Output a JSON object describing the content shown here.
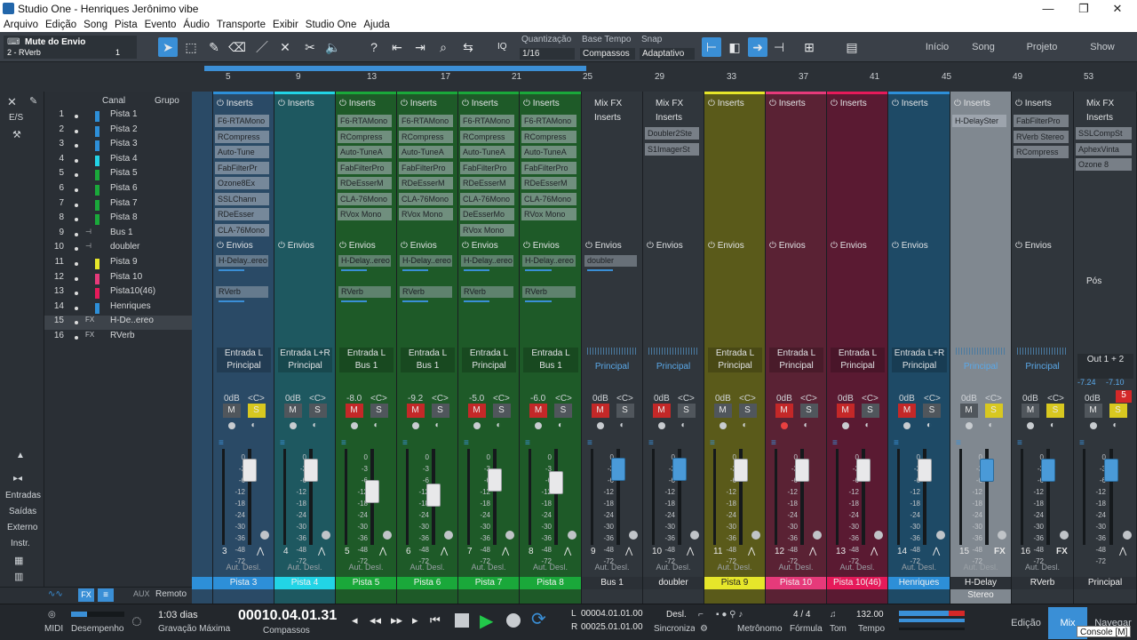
{
  "window": {
    "title": "Studio One - Henriques Jerônimo vibe",
    "min": "—",
    "max": "❐",
    "close": "✕"
  },
  "menu": [
    "Arquivo",
    "Edição",
    "Song",
    "Pista",
    "Evento",
    "Áudio",
    "Transporte",
    "Exibir",
    "Studio One",
    "Ajuda"
  ],
  "toolbar": {
    "track_label": "Mute do Envio",
    "track_sub": "2 - RVerb",
    "track_num": "1",
    "quant_label": "Quantização",
    "quant_value": "1/16",
    "timebase_label": "Base Tempo",
    "timebase_value": "Compassos",
    "snap_label": "Snap",
    "snap_value": "Adaptativo",
    "iq": "IQ",
    "nav": {
      "start": "Início",
      "song": "Song",
      "project": "Projeto",
      "show": "Show"
    }
  },
  "ruler": [
    "5",
    "9",
    "13",
    "17",
    "21",
    "25",
    "29",
    "33",
    "37",
    "41",
    "45",
    "49",
    "53"
  ],
  "left_tools": {
    "io": "E/S",
    "entradas": "Entradas",
    "saidas": "Saídas",
    "externo": "Externo",
    "instr": "Instr."
  },
  "chanlist": {
    "col_canal": "Canal",
    "col_grupo": "Grupo",
    "rows": [
      {
        "n": "1",
        "name": "Pista 1",
        "color": "#2d8fd8"
      },
      {
        "n": "2",
        "name": "Pista 2",
        "color": "#2d8fd8"
      },
      {
        "n": "3",
        "name": "Pista 3",
        "color": "#2d8fd8"
      },
      {
        "n": "4",
        "name": "Pista 4",
        "color": "#22d4e6"
      },
      {
        "n": "5",
        "name": "Pista 5",
        "color": "#1aa83a"
      },
      {
        "n": "6",
        "name": "Pista 6",
        "color": "#1aa83a"
      },
      {
        "n": "7",
        "name": "Pista 7",
        "color": "#1aa83a"
      },
      {
        "n": "8",
        "name": "Pista 8",
        "color": "#1aa83a"
      },
      {
        "n": "9",
        "name": "Bus 1",
        "color": ""
      },
      {
        "n": "10",
        "name": "doubler",
        "color": ""
      },
      {
        "n": "11",
        "name": "Pista 9",
        "color": "#e6e62a"
      },
      {
        "n": "12",
        "name": "Pista 10",
        "color": "#e63a7a"
      },
      {
        "n": "13",
        "name": "Pista10(46)",
        "color": "#e61a5a"
      },
      {
        "n": "14",
        "name": "Henriques",
        "color": "#2d8fd8"
      },
      {
        "n": "15",
        "name": "H-De..ereo",
        "color": ""
      },
      {
        "n": "16",
        "name": "RVerb",
        "color": ""
      }
    ]
  },
  "strips": [
    {
      "label": "Pista 3",
      "bg": "#2a4a66",
      "bar": "#2d8fd8",
      "in": "Entrada L",
      "out": "Principal",
      "gain": "0dB",
      "pan": "<C>",
      "num": "3",
      "inserts": [
        "F6-RTAMono",
        "RCompress",
        "Auto-Tune",
        "FabFilterPr",
        "Ozone8Ex",
        "SSLChann",
        "RDeEsser",
        "CLA-76Mono"
      ],
      "sends": [
        "H-Delay..ereo",
        "RVerb"
      ]
    },
    {
      "label": "Pista 4",
      "bg": "#1e5860",
      "bar": "#22d4e6",
      "in": "Entrada L+R",
      "out": "Principal",
      "gain": "0dB",
      "pan": "<C>",
      "num": "4",
      "inserts": [],
      "sends": []
    },
    {
      "label": "Pista 5",
      "bg": "#1e5a28",
      "bar": "#1aa83a",
      "in": "Entrada L",
      "out": "Bus 1",
      "gain": "-8.0",
      "pan": "<C>",
      "num": "5",
      "inserts": [
        "F6-RTAMono",
        "RCompress",
        "Auto-TuneA",
        "FabFilterPro",
        "RDeEsserM",
        "CLA-76Mono",
        "RVox Mono"
      ],
      "sends": [
        "H-Delay..ereo",
        "RVerb"
      ]
    },
    {
      "label": "Pista 6",
      "bg": "#1e5a28",
      "bar": "#1aa83a",
      "in": "Entrada L",
      "out": "Bus 1",
      "gain": "-9.2",
      "pan": "<C>",
      "num": "6",
      "inserts": [
        "F6-RTAMono",
        "RCompress",
        "Auto-TuneA",
        "FabFilterPro",
        "RDeEsserM",
        "CLA-76Mono",
        "RVox Mono"
      ],
      "sends": [
        "H-Delay..ereo",
        "RVerb"
      ]
    },
    {
      "label": "Pista 7",
      "bg": "#1e5a28",
      "bar": "#1aa83a",
      "in": "Entrada L",
      "out": "Principal",
      "gain": "-5.0",
      "pan": "<C>",
      "num": "7",
      "inserts": [
        "F6-RTAMono",
        "RCompress",
        "Auto-TuneA",
        "FabFilterPro",
        "RDeEsserM",
        "CLA-76Mono",
        "DeEsserMo",
        "RVox Mono"
      ],
      "sends": [
        "H-Delay..ereo",
        "RVerb"
      ]
    },
    {
      "label": "Pista 8",
      "bg": "#1e5a28",
      "bar": "#1aa83a",
      "in": "Entrada L",
      "out": "Bus 1",
      "gain": "-6.0",
      "pan": "<C>",
      "num": "8",
      "inserts": [
        "F6-RTAMono",
        "RCompress",
        "Auto-TuneA",
        "FabFilterPro",
        "RDeEsserM",
        "CLA-76Mono",
        "RVox Mono"
      ],
      "sends": [
        "H-Delay..ereo",
        "RVerb"
      ]
    },
    {
      "label": "Bus 1",
      "bg": "#30363c",
      "bar": "#30363c",
      "in": "",
      "out": "Principal",
      "gain": "0dB",
      "pan": "<C>",
      "num": "9",
      "inserts": [],
      "sends": [
        "doubler"
      ],
      "mixfx": "Mix FX"
    },
    {
      "label": "doubler",
      "bg": "#30363c",
      "bar": "#30363c",
      "in": "",
      "out": "Principal",
      "gain": "0dB",
      "pan": "<C>",
      "num": "10",
      "inserts": [
        "Doubler2Ste",
        "S1ImagerSt"
      ],
      "sends": [],
      "mixfx": "Mix FX"
    },
    {
      "label": "Pista 9",
      "bg": "#5a5a1a",
      "bar": "#e6e62a",
      "in": "Entrada L",
      "out": "Principal",
      "gain": "0dB",
      "pan": "<C>",
      "num": "11",
      "inserts": [],
      "sends": []
    },
    {
      "label": "Pista 10",
      "bg": "#5a2234",
      "bar": "#e63a7a",
      "in": "Entrada L",
      "out": "Principal",
      "gain": "0dB",
      "pan": "<C>",
      "num": "12",
      "inserts": [],
      "sends": []
    },
    {
      "label": "Pista 10(46)",
      "bg": "#5a1a32",
      "bar": "#e61a5a",
      "in": "Entrada L",
      "out": "Principal",
      "gain": "0dB",
      "pan": "<C>",
      "num": "13",
      "inserts": [],
      "sends": []
    },
    {
      "label": "Henriques",
      "bg": "#1e4a66",
      "bar": "#2d8fd8",
      "in": "Entrada L+R",
      "out": "Principal",
      "gain": "0dB",
      "pan": "<C>",
      "num": "14",
      "inserts": [],
      "sends": []
    },
    {
      "label": "H-Delay Stereo",
      "bg": "#808890",
      "bar": "#808890",
      "in": "",
      "out": "Principal",
      "gain": "0dB",
      "pan": "<C>",
      "num": "15",
      "inserts": [
        "H-DelaySter"
      ],
      "sends": [],
      "fx": "FX"
    },
    {
      "label": "RVerb",
      "bg": "#30363c",
      "bar": "#30363c",
      "in": "",
      "out": "Principal",
      "gain": "0dB",
      "pan": "<C>",
      "num": "16",
      "inserts": [
        "FabFilterPro",
        "RVerb Stereo",
        "RCompress"
      ],
      "sends": [],
      "fx": "FX"
    },
    {
      "label": "Principal",
      "bg": "#30363c",
      "bar": "#30363c",
      "in": "",
      "out": "Out 1 + 2",
      "gain": "0dB",
      "pan": "",
      "num": "",
      "inserts": [
        "SSLCompSt",
        "AphexVinta",
        "Ozone 8"
      ],
      "sends": [],
      "mixfx": "Mix FX",
      "post": "Pós",
      "meterL": "-7.24",
      "meterR": "-7.10"
    }
  ],
  "common": {
    "inserts": "Inserts",
    "envios": "Envios",
    "m": "M",
    "s": "S",
    "autodesl": "Aut. Desl.",
    "principal_label": "Principal",
    "fx": "FX"
  },
  "scale": [
    "0",
    "-3",
    "-6",
    "-12",
    "-18",
    "-24",
    "-30",
    "-36",
    "-48",
    "-72"
  ],
  "bottom_bar": {
    "aux": "AUX",
    "remoto": "Remoto",
    "fx": "FX"
  },
  "transport": {
    "midi": "MIDI",
    "desempenho": "Desempenho",
    "rec_time": "1:03 dias",
    "rec_label": "Gravação Máxima",
    "position": "00010.04.01.31",
    "pos_label": "Compassos",
    "L": "00004.01.01.00",
    "R": "00025.01.01.00",
    "desl": "Desl.",
    "sync": "Sincronizar",
    "metronome": "Metrônomo",
    "formula_val": "4 / 4",
    "formula": "Fórmula",
    "tom": "Tom",
    "tempo_val": "132.00",
    "tempo": "Tempo",
    "edicao": "Edição",
    "mix": "Mix",
    "navegar": "Navegar",
    "tooltip": "Console [M]"
  }
}
